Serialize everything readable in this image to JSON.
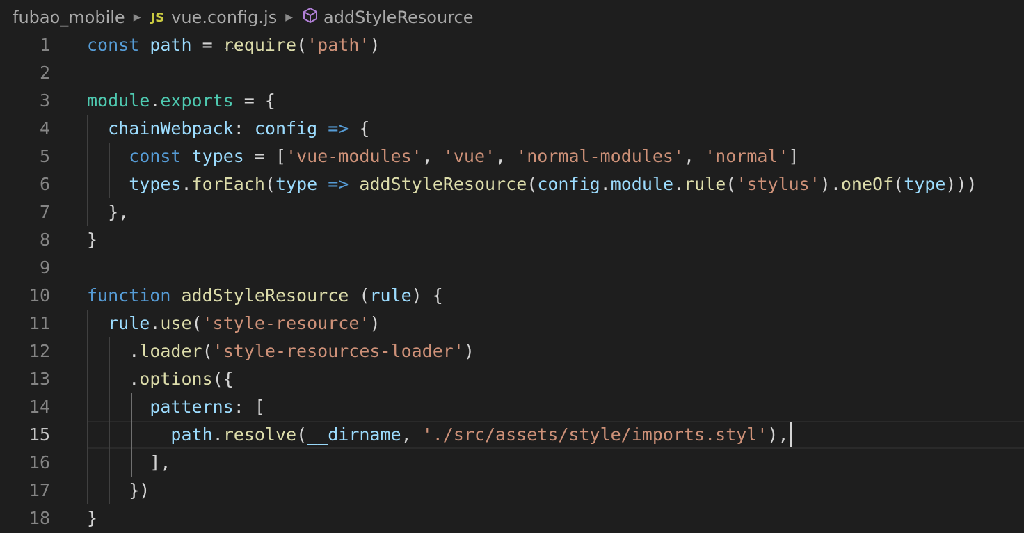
{
  "breadcrumb": {
    "folder": "fubao_mobile",
    "file_icon": "JS",
    "file": "vue.config.js",
    "symbol": "addStyleResource"
  },
  "editor": {
    "active_line": 15,
    "lines": [
      {
        "n": "1",
        "tokens": [
          [
            "kw",
            "const"
          ],
          [
            "pun",
            " "
          ],
          [
            "var",
            "path"
          ],
          [
            "pun",
            " = "
          ],
          [
            "fn",
            "require"
          ],
          [
            "pun",
            "("
          ],
          [
            "str",
            "'path'"
          ],
          [
            "pun",
            ")"
          ]
        ]
      },
      {
        "n": "2",
        "tokens": []
      },
      {
        "n": "3",
        "tokens": [
          [
            "cls",
            "module"
          ],
          [
            "pun",
            "."
          ],
          [
            "cls",
            "exports"
          ],
          [
            "pun",
            " = {"
          ]
        ]
      },
      {
        "n": "4",
        "tokens": [
          [
            "pun",
            "  "
          ],
          [
            "var",
            "chainWebpack"
          ],
          [
            "pun",
            ": "
          ],
          [
            "var",
            "config"
          ],
          [
            "pun",
            " "
          ],
          [
            "kw",
            "=>"
          ],
          [
            "pun",
            " {"
          ]
        ]
      },
      {
        "n": "5",
        "tokens": [
          [
            "pun",
            "    "
          ],
          [
            "kw",
            "const"
          ],
          [
            "pun",
            " "
          ],
          [
            "var",
            "types"
          ],
          [
            "pun",
            " = ["
          ],
          [
            "str",
            "'vue-modules'"
          ],
          [
            "pun",
            ", "
          ],
          [
            "str",
            "'vue'"
          ],
          [
            "pun",
            ", "
          ],
          [
            "str",
            "'normal-modules'"
          ],
          [
            "pun",
            ", "
          ],
          [
            "str",
            "'normal'"
          ],
          [
            "pun",
            "]"
          ]
        ]
      },
      {
        "n": "6",
        "tokens": [
          [
            "pun",
            "    "
          ],
          [
            "var",
            "types"
          ],
          [
            "pun",
            "."
          ],
          [
            "fn",
            "forEach"
          ],
          [
            "pun",
            "("
          ],
          [
            "var",
            "type"
          ],
          [
            "pun",
            " "
          ],
          [
            "kw",
            "=>"
          ],
          [
            "pun",
            " "
          ],
          [
            "fn",
            "addStyleResource"
          ],
          [
            "pun",
            "("
          ],
          [
            "var",
            "config"
          ],
          [
            "pun",
            "."
          ],
          [
            "var",
            "module"
          ],
          [
            "pun",
            "."
          ],
          [
            "fn",
            "rule"
          ],
          [
            "pun",
            "("
          ],
          [
            "str",
            "'stylus'"
          ],
          [
            "pun",
            ")."
          ],
          [
            "fn",
            "oneOf"
          ],
          [
            "pun",
            "("
          ],
          [
            "var",
            "type"
          ],
          [
            "pun",
            ")))"
          ]
        ]
      },
      {
        "n": "7",
        "tokens": [
          [
            "pun",
            "  },"
          ]
        ]
      },
      {
        "n": "8",
        "tokens": [
          [
            "pun",
            "}"
          ]
        ]
      },
      {
        "n": "9",
        "tokens": []
      },
      {
        "n": "10",
        "tokens": [
          [
            "kw",
            "function"
          ],
          [
            "pun",
            " "
          ],
          [
            "fn",
            "addStyleResource"
          ],
          [
            "pun",
            " ("
          ],
          [
            "var",
            "rule"
          ],
          [
            "pun",
            ") {"
          ]
        ]
      },
      {
        "n": "11",
        "tokens": [
          [
            "pun",
            "  "
          ],
          [
            "var",
            "rule"
          ],
          [
            "pun",
            "."
          ],
          [
            "fn",
            "use"
          ],
          [
            "pun",
            "("
          ],
          [
            "str",
            "'style-resource'"
          ],
          [
            "pun",
            ")"
          ]
        ]
      },
      {
        "n": "12",
        "tokens": [
          [
            "pun",
            "    ."
          ],
          [
            "fn",
            "loader"
          ],
          [
            "pun",
            "("
          ],
          [
            "str",
            "'style-resources-loader'"
          ],
          [
            "pun",
            ")"
          ]
        ]
      },
      {
        "n": "13",
        "tokens": [
          [
            "pun",
            "    ."
          ],
          [
            "fn",
            "options"
          ],
          [
            "pun",
            "({"
          ]
        ]
      },
      {
        "n": "14",
        "tokens": [
          [
            "pun",
            "      "
          ],
          [
            "var",
            "patterns"
          ],
          [
            "pun",
            ": ["
          ]
        ]
      },
      {
        "n": "15",
        "tokens": [
          [
            "pun",
            "        "
          ],
          [
            "var",
            "path"
          ],
          [
            "pun",
            "."
          ],
          [
            "fn",
            "resolve"
          ],
          [
            "pun",
            "("
          ],
          [
            "var",
            "__dirname"
          ],
          [
            "pun",
            ", "
          ],
          [
            "str",
            "'./src/assets/style/imports.styl'"
          ],
          [
            "pun",
            "),"
          ]
        ]
      },
      {
        "n": "16",
        "tokens": [
          [
            "pun",
            "      ],"
          ]
        ]
      },
      {
        "n": "17",
        "tokens": [
          [
            "pun",
            "    })"
          ]
        ]
      },
      {
        "n": "18",
        "tokens": [
          [
            "pun",
            "}"
          ]
        ]
      }
    ]
  }
}
